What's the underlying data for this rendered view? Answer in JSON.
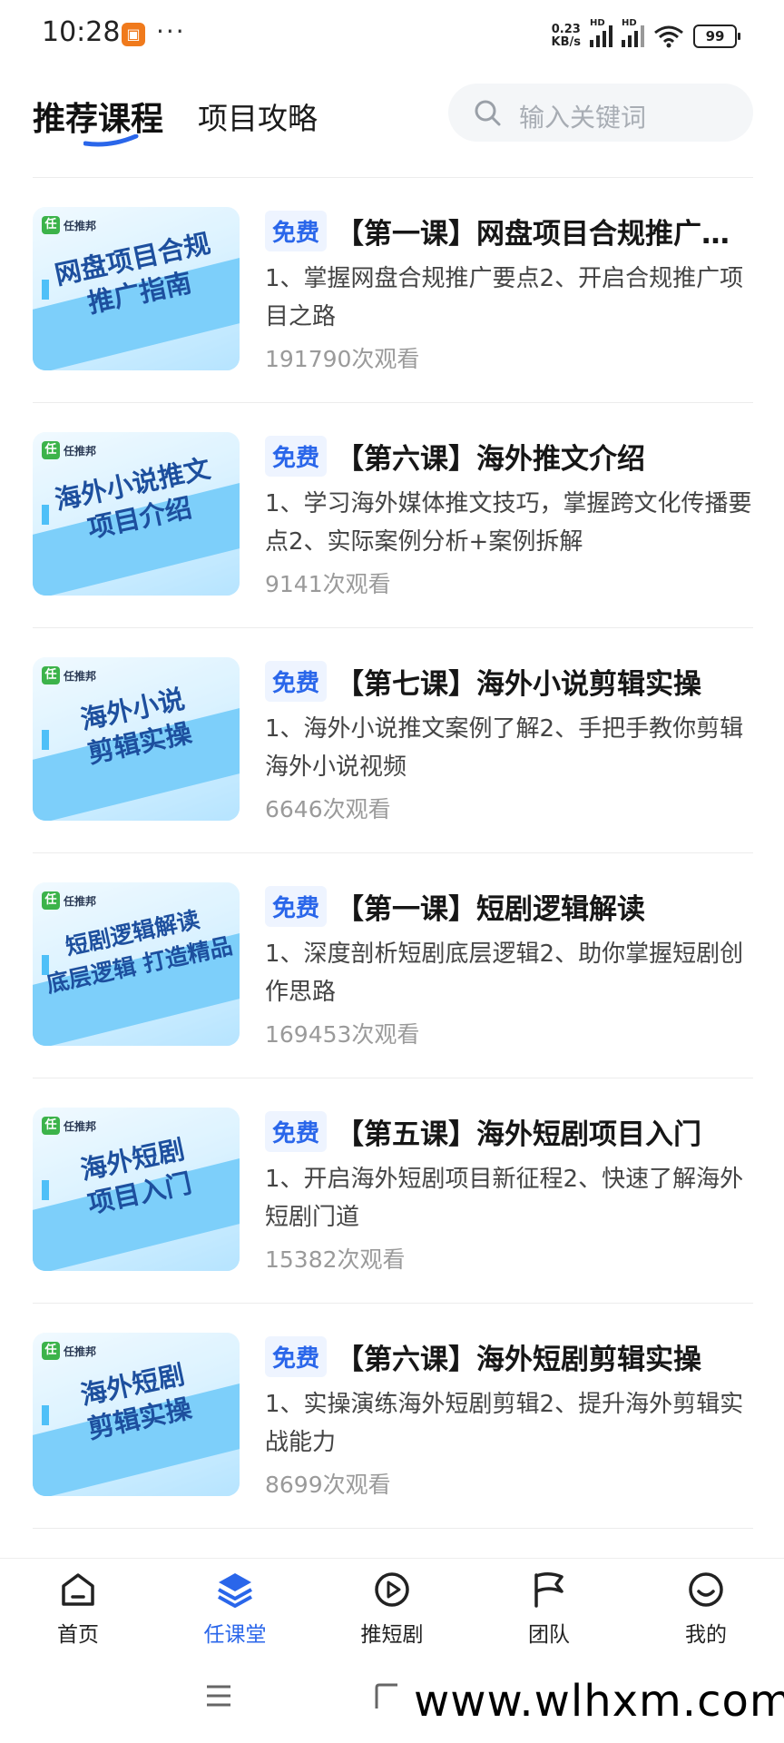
{
  "status_bar": {
    "time": "10:28",
    "more": "···",
    "net_speed_value": "0.23",
    "net_speed_unit": "KB/s",
    "hd1": "HD",
    "hd2": "HD",
    "battery": "99"
  },
  "header": {
    "tabs": [
      {
        "label": "推荐课程",
        "active": true
      },
      {
        "label": "项目攻略",
        "active": false
      }
    ],
    "search_placeholder": "输入关键词"
  },
  "courses": [
    {
      "badge": "免费",
      "title": "【第一课】网盘项目合规推广指南",
      "description": "1、掌握网盘合规推广要点2、开启合规推广项目之路",
      "views": "191790次观看",
      "thumb_lines": [
        "网盘项目合规",
        "推广指南"
      ],
      "thumb_logo": "任推邦"
    },
    {
      "badge": "免费",
      "title": "【第六课】海外推文介绍",
      "description": "1、学习海外媒体推文技巧，掌握跨文化传播要点2、实际案例分析+案例拆解",
      "views": "9141次观看",
      "thumb_lines": [
        "海外小说推文",
        "项目介绍"
      ],
      "thumb_logo": "任推邦"
    },
    {
      "badge": "免费",
      "title": "【第七课】海外小说剪辑实操",
      "description": "1、海外小说推文案例了解2、手把手教你剪辑海外小说视频",
      "views": "6646次观看",
      "thumb_lines": [
        "海外小说",
        "剪辑实操"
      ],
      "thumb_logo": "任推邦"
    },
    {
      "badge": "免费",
      "title": "【第一课】短剧逻辑解读",
      "description": "1、深度剖析短剧底层逻辑2、助你掌握短剧创作思路",
      "views": "169453次观看",
      "thumb_lines": [
        "短剧逻辑解读",
        "底层逻辑 打造精品"
      ],
      "thumb_logo": "任推邦"
    },
    {
      "badge": "免费",
      "title": "【第五课】海外短剧项目入门",
      "description": "1、开启海外短剧项目新征程2、快速了解海外短剧门道",
      "views": "15382次观看",
      "thumb_lines": [
        "海外短剧",
        "项目入门"
      ],
      "thumb_logo": "任推邦"
    },
    {
      "badge": "免费",
      "title": "【第六课】海外短剧剪辑实操",
      "description": "1、实操演练海外短剧剪辑2、提升海外剪辑实战能力",
      "views": "8699次观看",
      "thumb_lines": [
        "海外短剧",
        "剪辑实操"
      ],
      "thumb_logo": "任推邦"
    }
  ],
  "bottom_nav": [
    {
      "label": "首页",
      "icon": "home-icon",
      "active": false
    },
    {
      "label": "任课堂",
      "icon": "layers-icon",
      "active": true
    },
    {
      "label": "推短剧",
      "icon": "play-icon",
      "active": false
    },
    {
      "label": "团队",
      "icon": "flag-icon",
      "active": false
    },
    {
      "label": "我的",
      "icon": "smile-icon",
      "active": false
    }
  ],
  "watermark": "www.wlhxm.com",
  "colors": {
    "accent": "#2a66ea",
    "badge_bg": "#eef4ff",
    "thumb_blue": "#38b6f7"
  }
}
